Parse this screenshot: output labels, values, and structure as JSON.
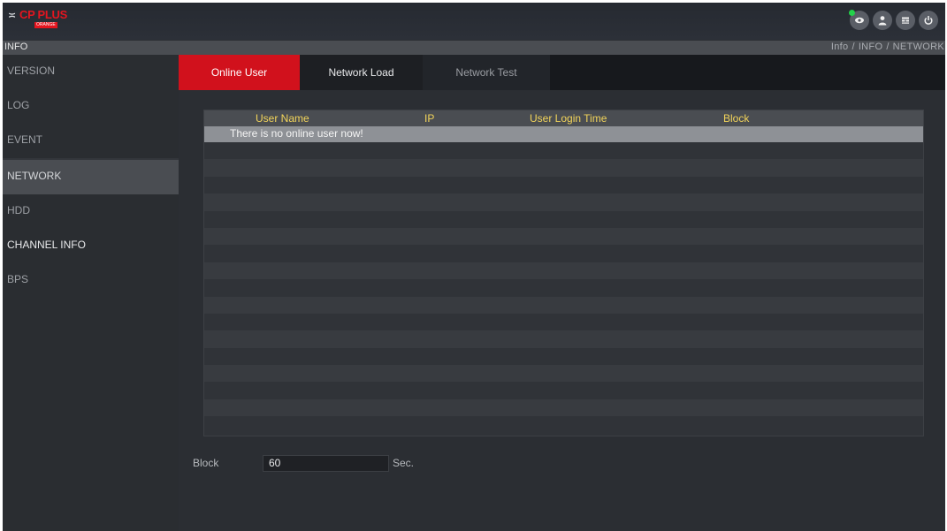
{
  "brand": {
    "logo_text": "CP PLUS",
    "logo_sub": "ORANGE",
    "accent_color": "#e4151f"
  },
  "header": {
    "icons": [
      "live-view-icon",
      "user-icon",
      "menu-icon",
      "power-icon"
    ]
  },
  "title_bar": {
    "title": "INFO",
    "breadcrumb": [
      "Info",
      "INFO",
      "NETWORK"
    ],
    "separator": "/"
  },
  "sidebar": {
    "items": [
      {
        "label": "VERSION"
      },
      {
        "label": "LOG"
      },
      {
        "label": "EVENT"
      },
      {
        "label": "NETWORK",
        "active": true
      },
      {
        "label": "HDD"
      },
      {
        "label": "CHANNEL INFO"
      },
      {
        "label": "BPS"
      }
    ]
  },
  "tabs": [
    {
      "label": "Online User",
      "active": true
    },
    {
      "label": "Network Load"
    },
    {
      "label": "Network Test"
    }
  ],
  "table": {
    "columns": [
      "User Name",
      "IP",
      "User Login Time",
      "Block"
    ],
    "empty_message": "There is no online user now!",
    "header_text_color": "#f2d45a"
  },
  "block_setting": {
    "label": "Block",
    "value": "60",
    "unit": "Sec."
  }
}
